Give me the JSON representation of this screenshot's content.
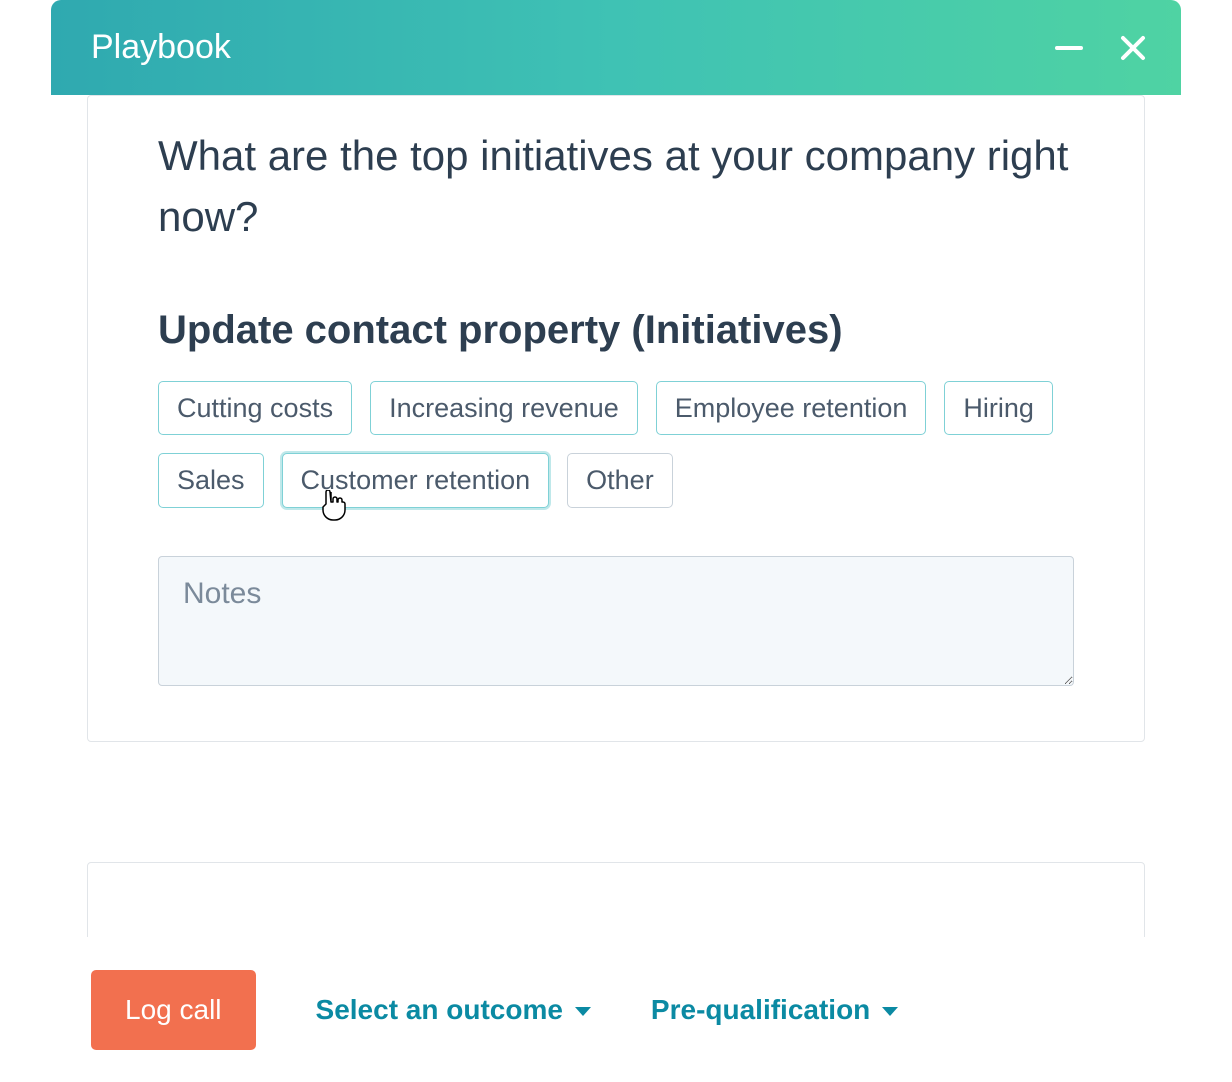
{
  "header": {
    "title": "Playbook"
  },
  "card": {
    "question": "What are the top initiatives at your company right now?",
    "section_title": "Update contact property (Initiatives)",
    "chips": [
      {
        "label": "Cutting costs",
        "state": "normal"
      },
      {
        "label": "Increasing revenue",
        "state": "normal"
      },
      {
        "label": "Employee retention",
        "state": "normal"
      },
      {
        "label": "Hiring",
        "state": "normal"
      },
      {
        "label": "Sales",
        "state": "normal"
      },
      {
        "label": "Customer retention",
        "state": "hover"
      },
      {
        "label": "Other",
        "state": "plain"
      }
    ],
    "notes_placeholder": "Notes",
    "notes_value": ""
  },
  "footer": {
    "log_call_label": "Log call",
    "outcome_label": "Select an outcome",
    "type_label": "Pre-qualification"
  },
  "colors": {
    "accent_teal": "#0b8aa3",
    "primary_orange": "#f2704f",
    "chip_border": "#7fd1d6",
    "text_dark": "#2d3e50"
  }
}
